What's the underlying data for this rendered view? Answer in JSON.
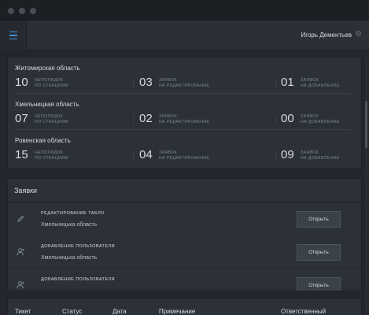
{
  "header": {
    "user_name": "Игорь Дементьев",
    "icons": {
      "menu": "hamburger-icon",
      "settings": "gear-icon"
    },
    "accent_color": "#3f8fd8"
  },
  "regions": [
    {
      "title": "Житомирская область",
      "stats": [
        {
          "value": "10",
          "label_line1": "Неполадок",
          "label_line2": "по станциям"
        },
        {
          "value": "03",
          "label_line1": "Заявок",
          "label_line2": "на редактирование"
        },
        {
          "value": "01",
          "label_line1": "Заявок",
          "label_line2": "на добавление"
        }
      ]
    },
    {
      "title": "Хмельницкая область",
      "stats": [
        {
          "value": "07",
          "label_line1": "Неполадок",
          "label_line2": "по станциям"
        },
        {
          "value": "02",
          "label_line1": "Заявок",
          "label_line2": "на редактирование"
        },
        {
          "value": "00",
          "label_line1": "Заявок",
          "label_line2": "на добавление"
        }
      ]
    },
    {
      "title": "Ровенская область",
      "stats": [
        {
          "value": "15",
          "label_line1": "Неполадок",
          "label_line2": "по станциям"
        },
        {
          "value": "04",
          "label_line1": "Заявок",
          "label_line2": "на редактирование"
        },
        {
          "value": "09",
          "label_line1": "Заявок",
          "label_line2": "на добавление"
        }
      ]
    }
  ],
  "requests": {
    "title": "Заявки",
    "items": [
      {
        "type": "Редактирование табло",
        "region": "Хмельницька область",
        "button": "Открыть",
        "icon": "pencil-icon"
      },
      {
        "type": "Добавление пользователя",
        "region": "Хмельницька область",
        "button": "Открыть",
        "icon": "user-add-icon"
      },
      {
        "type": "Добавление пользователя",
        "region": "",
        "button": "Открыть",
        "icon": "user-add-icon"
      }
    ]
  },
  "table": {
    "columns": [
      "Тикет",
      "Статус",
      "Дата",
      "Примечание",
      "Ответственный"
    ]
  }
}
